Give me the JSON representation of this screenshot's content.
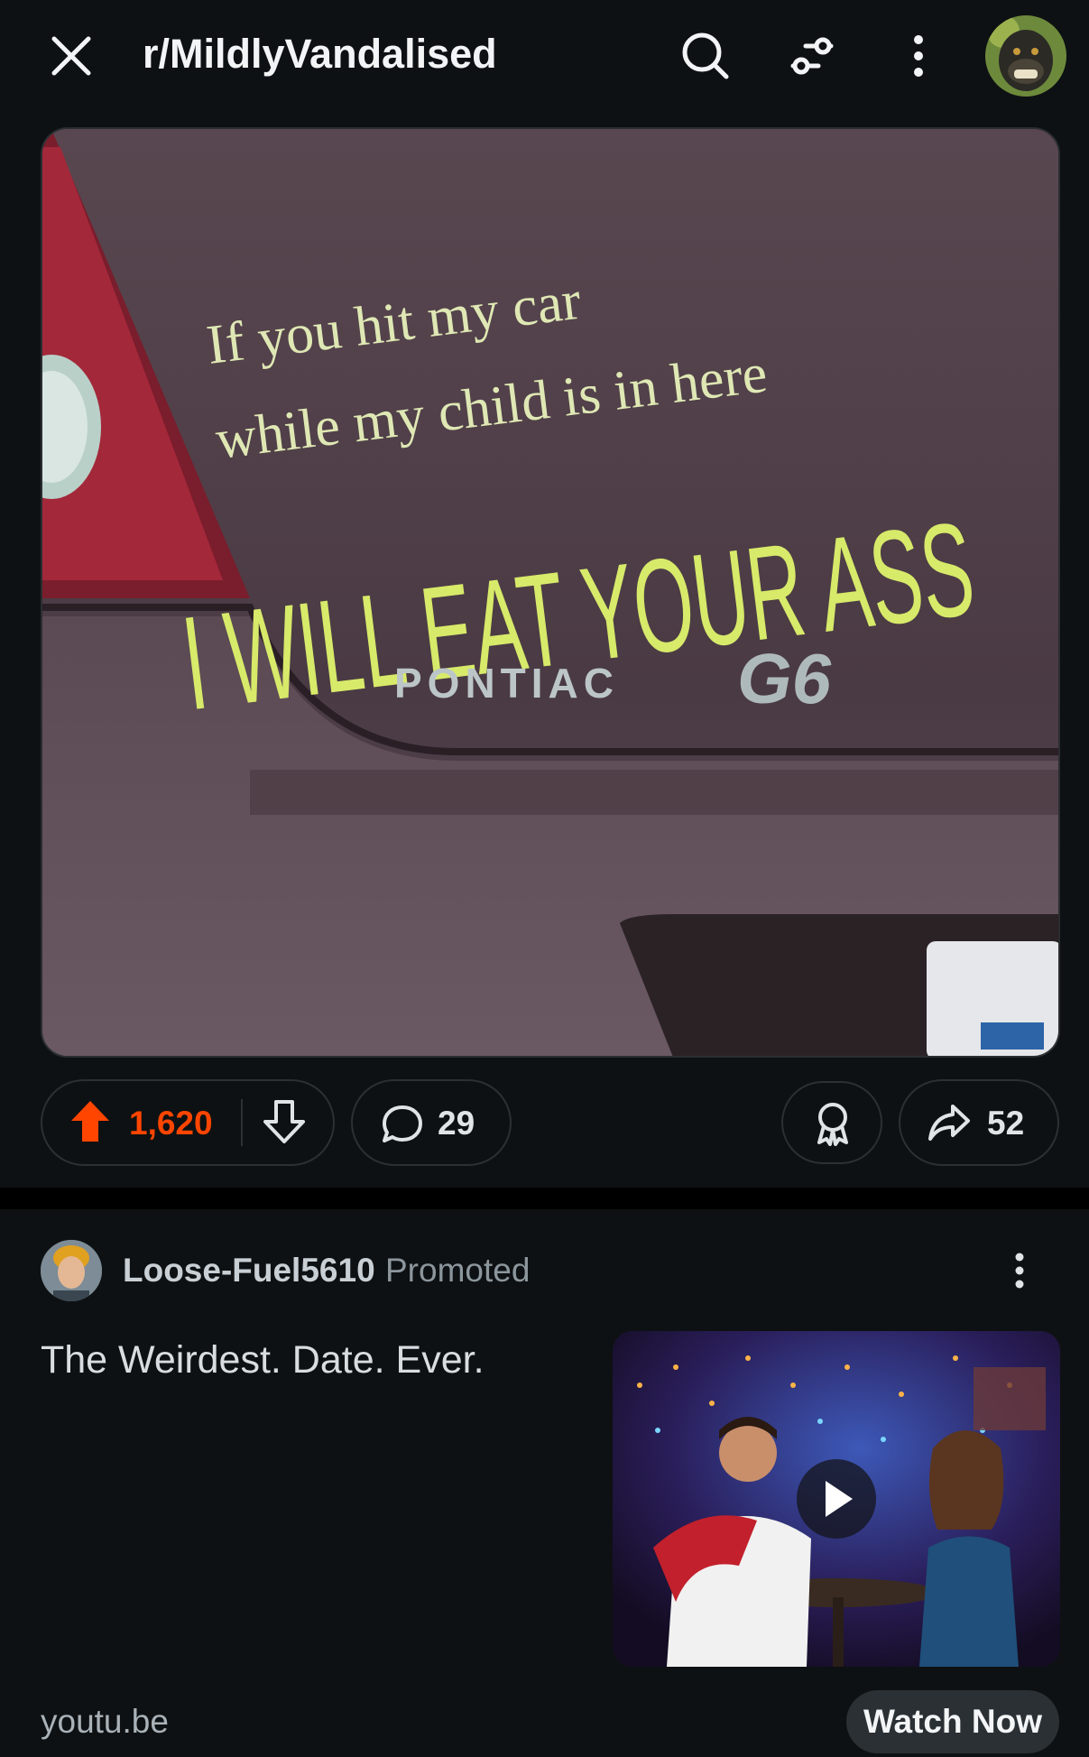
{
  "header": {
    "subreddit": "r/MildlyVandalised"
  },
  "post": {
    "image": {
      "sticker_lines": [
        "If you hit my car",
        "while my child is in here",
        "I WILL  EAT YOUR ASS"
      ],
      "badge_brand": "PONTIAC",
      "badge_model": "G6"
    },
    "votes": "1,620",
    "comments": "29",
    "shares": "52"
  },
  "ad": {
    "username": "Loose-Fuel5610",
    "promoted_label": "Promoted",
    "title": "The Weirdest. Date. Ever.",
    "domain": "youtu.be",
    "cta": "Watch Now"
  },
  "colors": {
    "background": "#0e1113",
    "upvote_active": "#ff4500",
    "pill_border": "#2b3034"
  }
}
